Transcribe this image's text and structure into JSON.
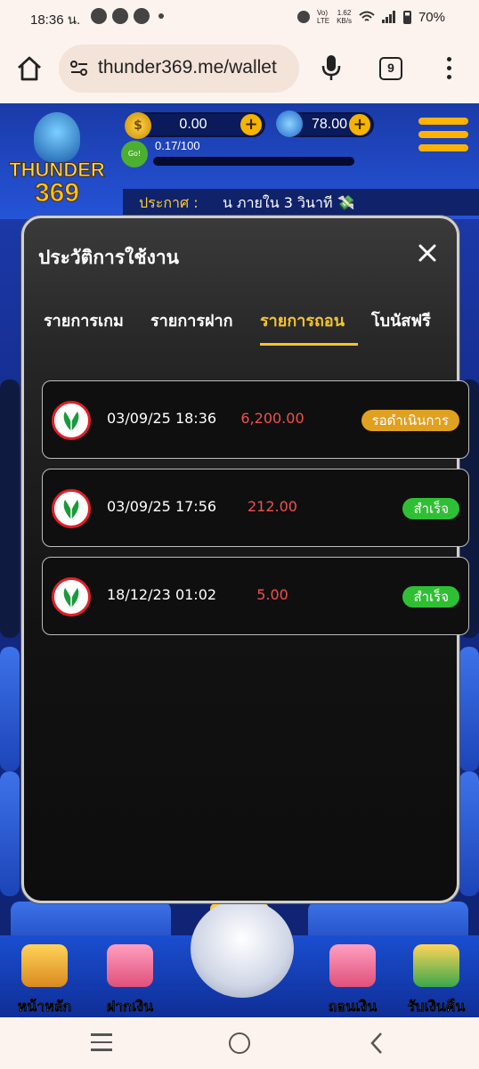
{
  "status_bar": {
    "time": "18:36 น.",
    "net_speed": "1.62\nKB/s",
    "battery": "70%"
  },
  "browser": {
    "url": "thunder369.me/wallet",
    "tab_count": "9"
  },
  "game_header": {
    "logo_line1": "THUNDER",
    "logo_line2": "369",
    "coin_balance": "0.00",
    "gem_balance": "78.00",
    "xp_text": "0.17/100",
    "xp_badge": "Ready Go!",
    "announce_label": "ประกาศ :",
    "announce_message": "น ภายใน 3 วินาที 💸"
  },
  "modal": {
    "title": "ประวัติการใช้งาน",
    "tabs": [
      {
        "label": "รายการเกม",
        "active": false
      },
      {
        "label": "รายการฝาก",
        "active": false
      },
      {
        "label": "รายการถอน",
        "active": true
      },
      {
        "label": "โบนัสฟรี",
        "active": false
      }
    ],
    "records": [
      {
        "datetime": "03/09/25 18:36",
        "amount": "6,200.00",
        "status": "รอดำเนินการ",
        "status_type": "pending"
      },
      {
        "datetime": "03/09/25 17:56",
        "amount": "212.00",
        "status": "สำเร็จ",
        "status_type": "success"
      },
      {
        "datetime": "18/12/23 01:02",
        "amount": "5.00",
        "status": "สำเร็จ",
        "status_type": "success"
      }
    ]
  },
  "bottom_nav": {
    "items": [
      {
        "label": "หน้าหลัก"
      },
      {
        "label": "ฝากเงิน"
      },
      {
        "label": "ถอนเงิน"
      },
      {
        "label": "รับเงินคืน"
      }
    ]
  },
  "colors": {
    "accent": "#f2c431",
    "amount": "#f05050",
    "pending": "#e0a020",
    "success": "#2fbf34"
  }
}
